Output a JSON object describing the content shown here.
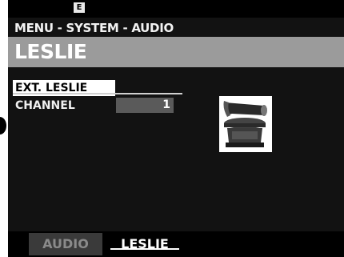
{
  "status_bar": {
    "icon_letter": "E"
  },
  "breadcrumb": "MENU - SYSTEM - AUDIO",
  "page_title": "LESLIE",
  "params": [
    {
      "label": "EXT. LESLIE",
      "value": ""
    },
    {
      "label": "CHANNEL",
      "value": "1"
    }
  ],
  "tabs": [
    {
      "label": "AUDIO",
      "active": false
    },
    {
      "label": "LESLIE",
      "active": true
    }
  ],
  "colors": {
    "background": "#121212",
    "title_bar": "#9b9b9b",
    "highlight": "#ffffff",
    "value_field": "#5a5a5a"
  },
  "icons": {
    "speaker": "leslie-speaker-icon"
  }
}
